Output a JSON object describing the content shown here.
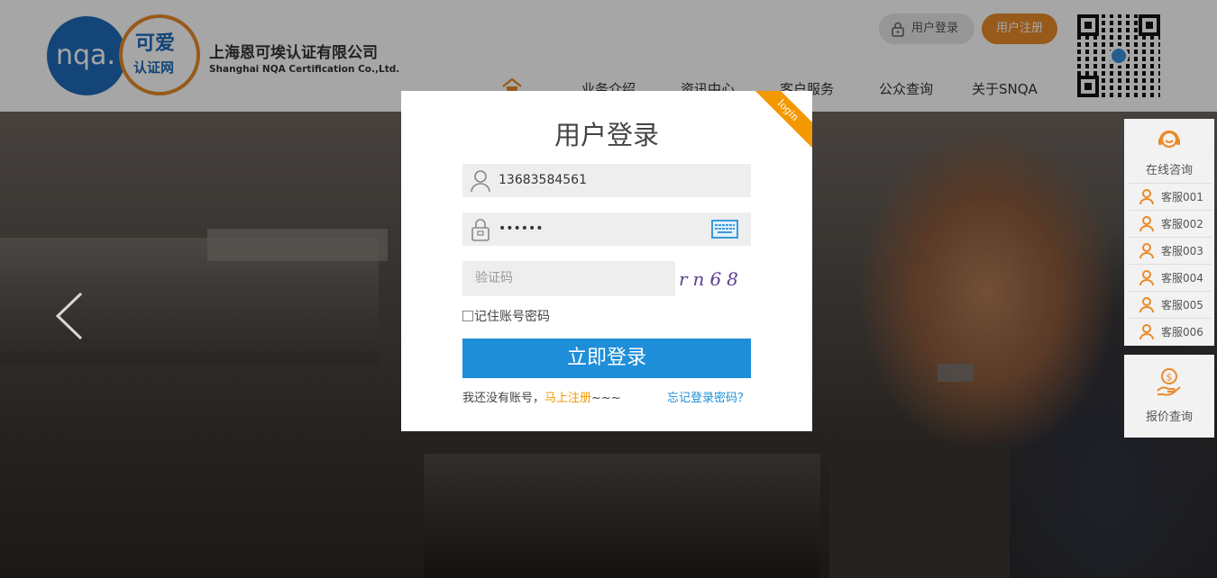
{
  "header": {
    "logo": {
      "abbr": "nqa.",
      "brand_top": "可爱",
      "brand_bottom": "认证网"
    },
    "company_cn": "上海恩可埃认证有限公司",
    "company_en": "Shanghai NQA Certification Co.,Ltd.",
    "login_button": "用户登录",
    "register_button": "用户注册",
    "nav": [
      "业务介绍",
      "资讯中心",
      "客户服务",
      "公众查询",
      "关于SNQA"
    ],
    "home_icon": "home-icon",
    "accent_color": "#e98b2a",
    "brand_color": "#1e6bb8"
  },
  "side_panel": {
    "consult_title": "在线咨询",
    "agents": [
      "客服001",
      "客服002",
      "客服003",
      "客服004",
      "客服005",
      "客服006"
    ],
    "quote_title": "报价查询"
  },
  "modal": {
    "ribbon": "login",
    "title": "用户登录",
    "username_value": "13683584561",
    "password_value": "••••••",
    "captcha_placeholder": "验证码",
    "captcha_text": "rn68",
    "remember_label": "记住账号密码",
    "submit_label": "立即登录",
    "no_account_text": "我还没有账号，",
    "register_link": "马上注册",
    "register_suffix": "~~~",
    "forgot_link": "忘记登录密码？",
    "button_color": "#1e8ed8"
  }
}
